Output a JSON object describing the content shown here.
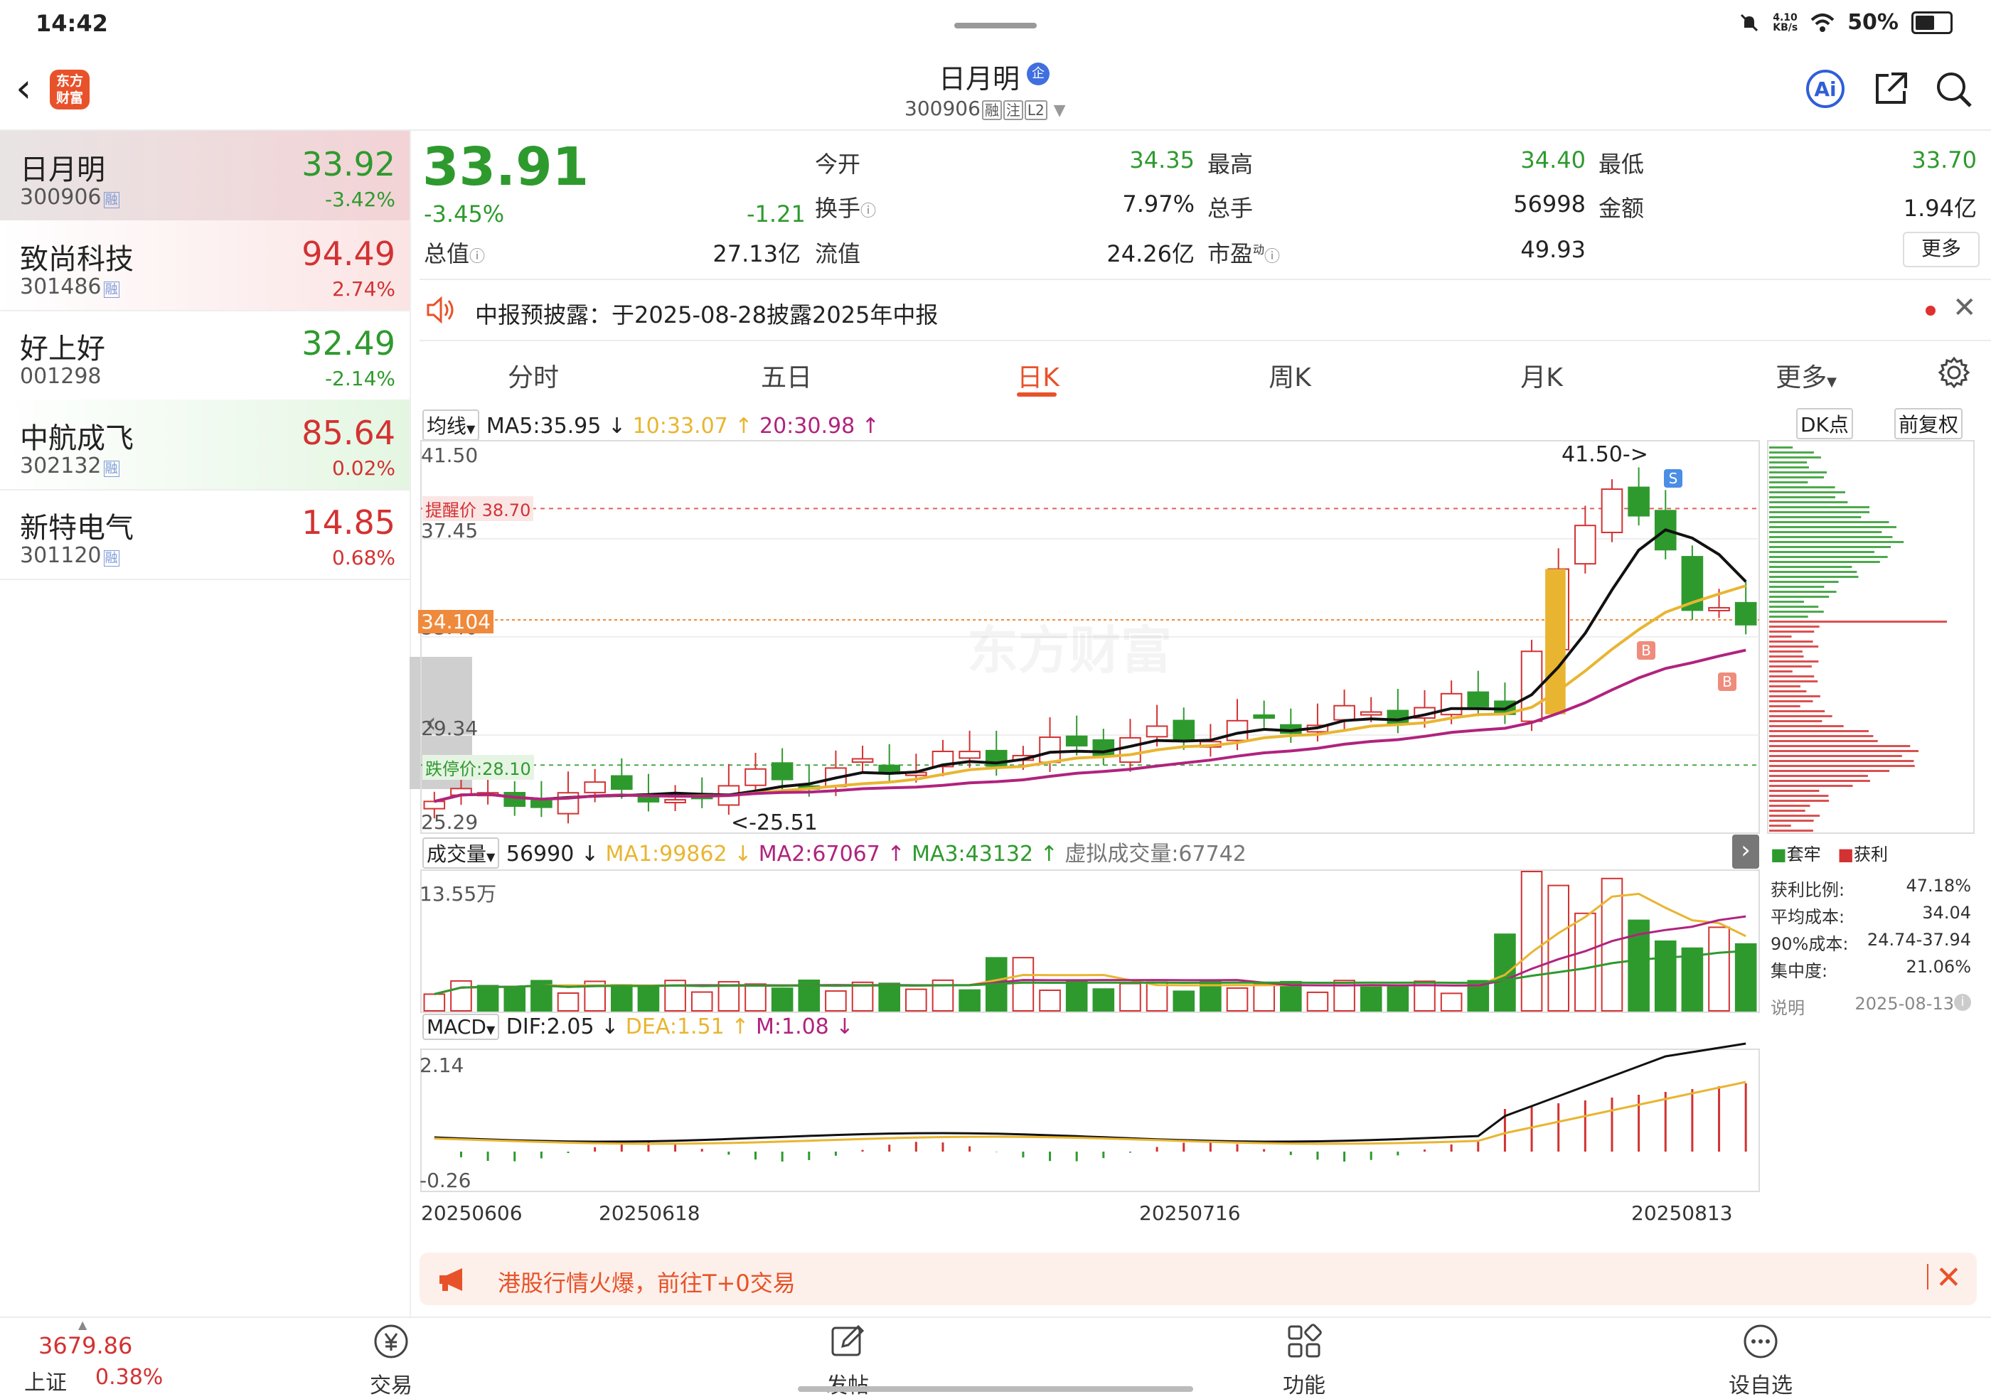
{
  "status_bar": {
    "time": "14:42",
    "net_speed": "4.10\nKB/s",
    "battery": "50%"
  },
  "header": {
    "app_logo": "东方\n财富",
    "stock_name": "日月明",
    "badge": "企",
    "stock_code": "300906",
    "tags": [
      "融",
      "注",
      "L2"
    ]
  },
  "watchlist": [
    {
      "name": "日月明",
      "code": "300906",
      "tag": "融",
      "price": "33.92",
      "change": "-3.42%",
      "dir": "down"
    },
    {
      "name": "致尚科技",
      "code": "301486",
      "tag": "融",
      "price": "94.49",
      "change": "2.74%",
      "dir": "up"
    },
    {
      "name": "好上好",
      "code": "001298",
      "tag": "",
      "price": "32.49",
      "change": "-2.14%",
      "dir": "down"
    },
    {
      "name": "中航成飞",
      "code": "302132",
      "tag": "融",
      "price": "85.64",
      "change": "0.02%",
      "dir": "up"
    },
    {
      "name": "新特电气",
      "code": "301120",
      "tag": "融",
      "price": "14.85",
      "change": "0.68%",
      "dir": "up"
    }
  ],
  "quote": {
    "price": "33.91",
    "change_pct": "-3.45%",
    "change": "-1.21",
    "total_value_label": "总值",
    "total_value": "27.13亿",
    "open_label": "今开",
    "open": "34.35",
    "high_label": "最高",
    "high": "34.40",
    "low_label": "最低",
    "low": "33.70",
    "turnover_label": "换手",
    "turnover": "7.97%",
    "volume_label": "总手",
    "volume": "56998",
    "amount_label": "金额",
    "amount": "1.94亿",
    "float_label": "流值",
    "float_value": "24.26亿",
    "pe_label": "市盈",
    "pe_sup": "动",
    "pe": "49.93",
    "more_label": "更多"
  },
  "notice": {
    "text": "中报预披露：于2025-08-28披露2025年中报"
  },
  "tabs": [
    "分时",
    "五日",
    "日K",
    "周K",
    "月K",
    "更多"
  ],
  "active_tab": "日K",
  "kline_legend": {
    "selector": "均线",
    "ma5": "MA5:35.95 ↓",
    "ma10": "10:33.07 ↑",
    "ma20": "20:30.98 ↑",
    "dk": "DK点",
    "adjust": "前复权"
  },
  "kline_axis": {
    "y_top": "41.50",
    "y2": "37.45",
    "y3": "33.40",
    "y4": "29.34",
    "y_bottom": "25.29",
    "alert_label": "提醒价 38.70",
    "limit_down_label": "跌停价:28.10",
    "current_label": "34.104",
    "max_note": "41.50->",
    "min_note": "<-25.51",
    "buy_mark": "B",
    "sell_mark": "S",
    "watermark": "东方财富"
  },
  "volume_legend": {
    "selector": "成交量",
    "vol": "56990 ↓",
    "ma1": "MA1:99862 ↓",
    "ma2": "MA2:67067 ↑",
    "ma3": "MA3:43132 ↑",
    "virtual": "虚拟成交量:67742",
    "y_top": "13.55万"
  },
  "macd_legend": {
    "selector": "MACD",
    "dif": "DIF:2.05 ↓",
    "dea": "DEA:1.51 ↑",
    "m": "M:1.08 ↓",
    "y_top": "2.14",
    "y_bottom": "-0.26"
  },
  "x_dates": [
    "20250606",
    "20250618",
    "20250716",
    "20250813"
  ],
  "chip_distribution": {
    "legend_trapped": "套牢",
    "legend_profit": "获利",
    "rows": [
      {
        "label": "获利比例:",
        "value": "47.18%"
      },
      {
        "label": "平均成本:",
        "value": "34.04"
      },
      {
        "label": "90%成本:",
        "value": "24.74-37.94"
      },
      {
        "label": "集中度:",
        "value": "21.06%"
      }
    ],
    "note_label": "说明",
    "date": "2025-08-13"
  },
  "banner": {
    "text": "港股行情火爆，前往T+0交易"
  },
  "bottom_nav": {
    "index_value": "3679.86",
    "index_name": "上证",
    "index_change": "0.38%",
    "items": [
      "交易",
      "发帖",
      "功能",
      "设自选"
    ]
  },
  "colors": {
    "up": "#d33232",
    "down": "#2e9a2e",
    "accent": "#e8522a",
    "ma5": "#111111",
    "ma10": "#e9b531",
    "ma20": "#b0237e"
  }
}
